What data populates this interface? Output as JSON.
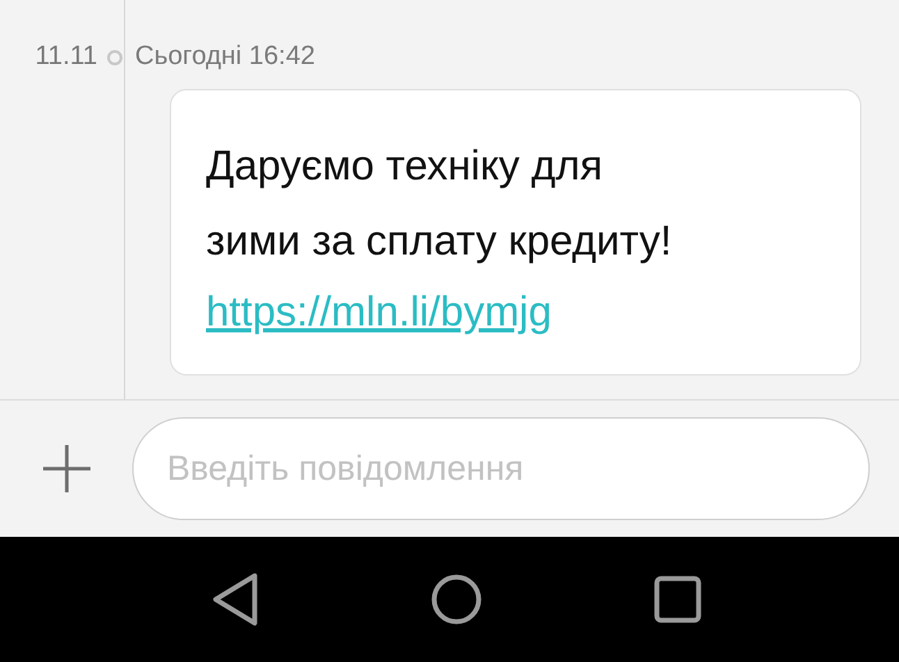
{
  "conversation": {
    "date": "11.11",
    "timestamp": "Сьогодні 16:42",
    "messages": [
      {
        "text": "Даруємо техніку для\nзими за сплату кредиту!",
        "link": "https://mln.li/bymjg"
      }
    ]
  },
  "composer": {
    "placeholder": "Введіть повідомлення"
  }
}
